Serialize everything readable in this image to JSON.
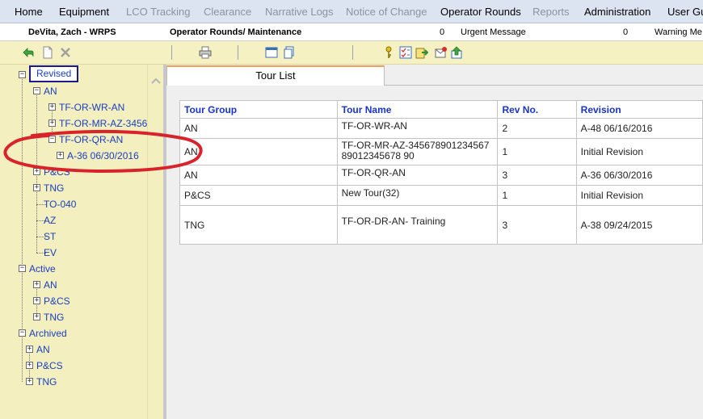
{
  "menu": [
    {
      "label": "Home",
      "enabled": true
    },
    {
      "label": "Equipment",
      "enabled": true
    },
    {
      "label": "LCO Tracking",
      "enabled": false
    },
    {
      "label": "Clearance",
      "enabled": false
    },
    {
      "label": "Narrative Logs",
      "enabled": false
    },
    {
      "label": "Notice of Change",
      "enabled": false
    },
    {
      "label": "Operator Rounds",
      "enabled": true
    },
    {
      "label": "Reports",
      "enabled": false
    },
    {
      "label": "Administration",
      "enabled": true
    },
    {
      "label": "User Gui",
      "enabled": true
    }
  ],
  "infobar": {
    "user": "DeVita, Zach - WRPS",
    "module": "Operator Rounds/ Maintenance",
    "urgent_count": "0",
    "urgent_label": "Urgent Message",
    "warning_count": "0",
    "warning_label": "Warning Me"
  },
  "toolbar": {
    "icons": [
      "back-arrow-icon",
      "new-document-icon",
      "delete-icon",
      "print-icon",
      "window-icon",
      "copy-icon",
      "key-icon",
      "checklist-icon",
      "export-icon",
      "mail-icon",
      "upload-icon"
    ]
  },
  "tree": {
    "revised": "Revised",
    "revised_an": "AN",
    "tf_or_wr_an": "TF-OR-WR-AN",
    "tf_or_mr_az": "TF-OR-MR-AZ-3456",
    "tf_or_qr_an": "TF-OR-QR-AN",
    "a36": "A-36 06/30/2016",
    "revised_pcs": "P&CS",
    "revised_tng": "TNG",
    "to040": "TO-040",
    "az": "AZ",
    "st": "ST",
    "ev": "EV",
    "active": "Active",
    "active_an": "AN",
    "active_pcs": "P&CS",
    "active_tng": "TNG",
    "archived": "Archived",
    "archived_an": "AN",
    "archived_pcs": "P&CS",
    "archived_tng": "TNG"
  },
  "content": {
    "tab_label": "Tour List",
    "columns": [
      "Tour Group",
      "Tour Name",
      "Rev No.",
      "Revision"
    ],
    "rows": [
      {
        "group": "AN",
        "name": "TF-OR-WR-AN",
        "rev": "2",
        "revision": "A-48 06/16/2016"
      },
      {
        "group": "AN",
        "name": "TF-OR-MR-AZ-34567890123456789012345678 90",
        "rev": "1",
        "revision": "Initial Revision"
      },
      {
        "group": "AN",
        "name": "TF-OR-QR-AN",
        "rev": "3",
        "revision": "A-36 06/30/2016"
      },
      {
        "group": "P&CS",
        "name": "New Tour(32)",
        "rev": "1",
        "revision": "Initial Revision"
      },
      {
        "group": "TNG",
        "name": "TF-OR-DR-AN- Training",
        "rev": "3",
        "revision": "A-38 09/24/2015"
      }
    ]
  },
  "colors": {
    "menu_bg": "#dce4f2",
    "panel_bg": "#f3efbf",
    "link_blue": "#1a3fc0",
    "header_blue": "#1a33c8",
    "annotation_red": "#d9232b",
    "tab_accent": "#f0a14a"
  }
}
